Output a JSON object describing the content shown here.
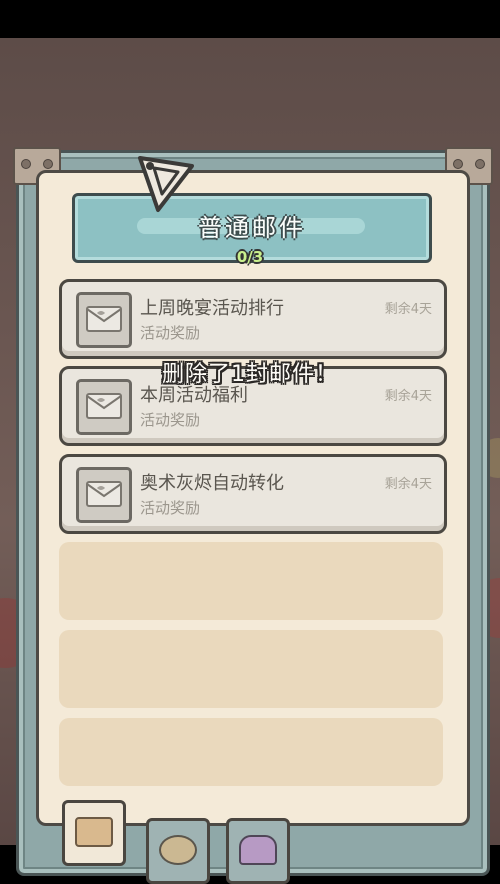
{
  "header": {
    "title": "普通邮件",
    "counter": "0/3"
  },
  "toast": "删除了1封邮件！",
  "mails": [
    {
      "title": "上周晚宴活动排行",
      "subtitle": "活动奖励",
      "remaining": "剩余4天"
    },
    {
      "title": "本周活动福利",
      "subtitle": "活动奖励",
      "remaining": "剩余4天"
    },
    {
      "title": "奥术灰烬自动转化",
      "subtitle": "活动奖励",
      "remaining": "剩余4天"
    }
  ],
  "tabs": [
    {
      "icon": "mail-tab-icon",
      "active": true
    },
    {
      "icon": "snail-tab-icon",
      "active": false
    },
    {
      "icon": "character-tab-icon",
      "active": false
    }
  ],
  "colors": {
    "banner": "#8dc1c3",
    "paper": "#f4ead8",
    "counter": "#c9ef8d",
    "mail_card": "#eae6de"
  }
}
